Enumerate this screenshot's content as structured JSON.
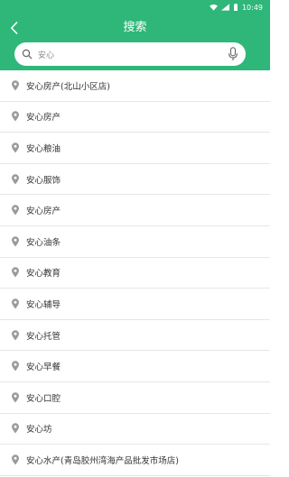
{
  "status": {
    "time": "10:49"
  },
  "header": {
    "title": "搜索",
    "search_value": "安心",
    "search_placeholder": ""
  },
  "results": [
    {
      "label": "安心房产(北山小区店)"
    },
    {
      "label": "安心房产"
    },
    {
      "label": "安心粮油"
    },
    {
      "label": "安心服饰"
    },
    {
      "label": "安心房产"
    },
    {
      "label": "安心油条"
    },
    {
      "label": "安心教育"
    },
    {
      "label": "安心辅导"
    },
    {
      "label": "安心托管"
    },
    {
      "label": "安心早餐"
    },
    {
      "label": "安心口腔"
    },
    {
      "label": "安心坊"
    },
    {
      "label": "安心水产(青岛胶州湾海产品批发市场店)"
    }
  ],
  "colors": {
    "accent": "#2fb77a",
    "pin": "#9a9a9a",
    "divider": "#e6e6e6"
  },
  "icons": {
    "back": "chevron-left-icon",
    "search": "search-icon",
    "mic": "microphone-icon",
    "pin": "location-pin-icon"
  }
}
